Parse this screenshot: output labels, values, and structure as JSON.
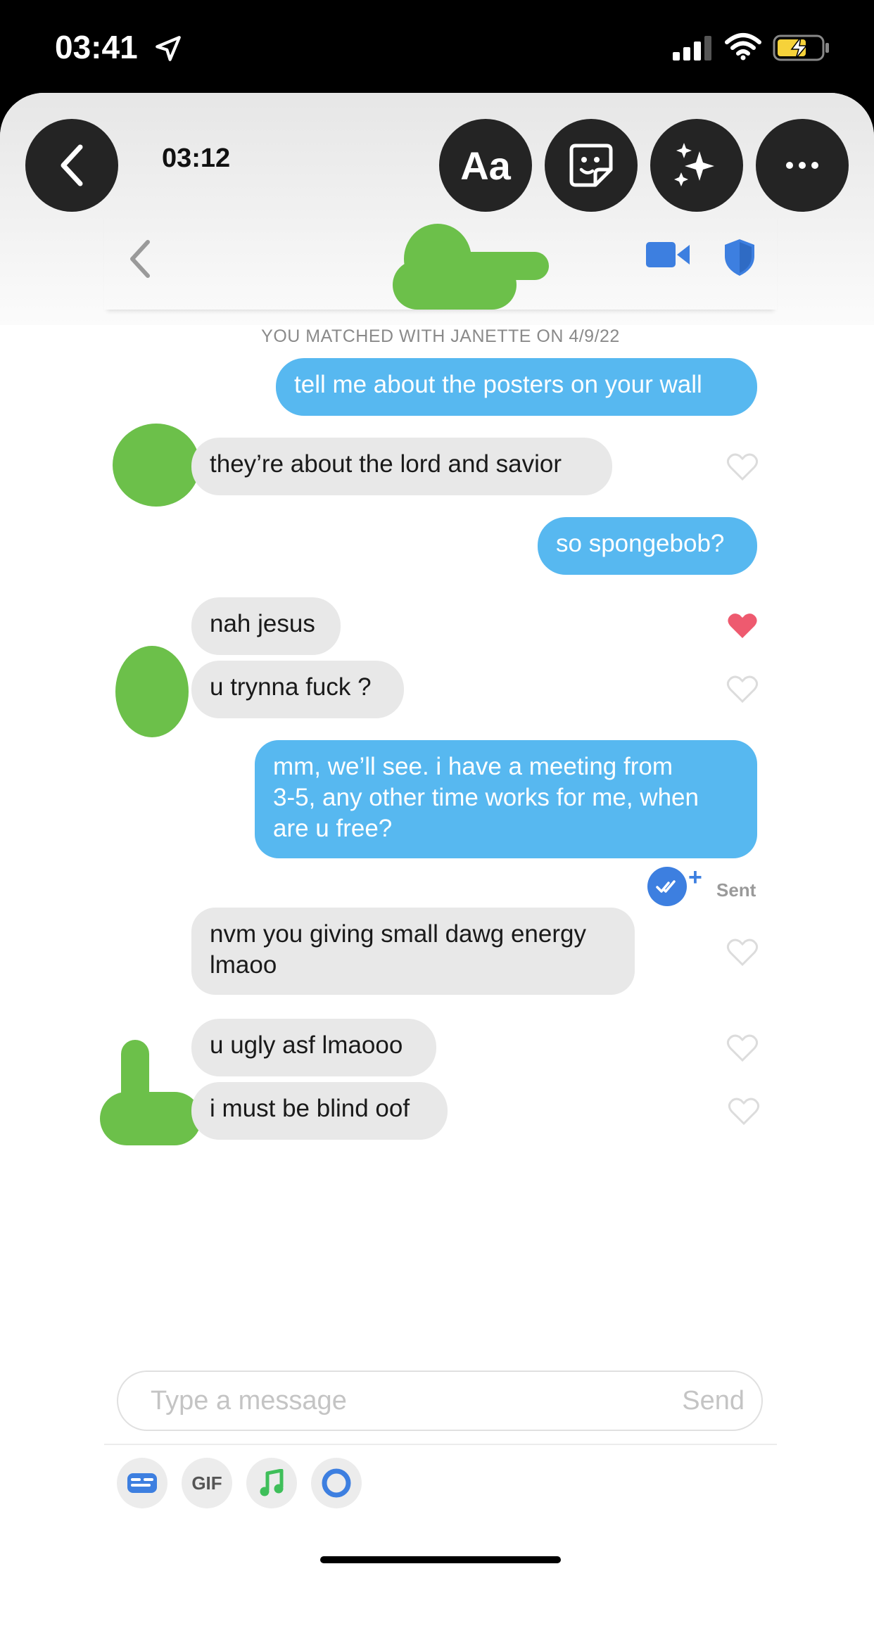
{
  "status_bar": {
    "time": "03:41",
    "icons": [
      "location-arrow-icon",
      "cellular-signal-icon",
      "wifi-icon",
      "battery-charging-icon"
    ]
  },
  "story": {
    "elapsed_time": "03:12",
    "text_tool_label": "Aa",
    "icons": [
      "back-chevron-icon",
      "sticker-icon",
      "sparkle-effects-icon",
      "more-options-icon"
    ]
  },
  "chat": {
    "header_icons": [
      "back-chevron-icon",
      "video-camera-icon",
      "shield-icon"
    ],
    "match_label": "YOU MATCHED WITH JANETTE ON 4/9/22",
    "messages": [
      {
        "from": "me",
        "text": "tell me about the posters on your wall"
      },
      {
        "from": "them",
        "text": "they’re about the lord and savior",
        "liked": false
      },
      {
        "from": "me",
        "text": "so spongebob?"
      },
      {
        "from": "them",
        "text": "nah jesus",
        "liked": true
      },
      {
        "from": "them",
        "text": "u trynna fuck ?",
        "liked": false
      },
      {
        "from": "me",
        "lines": [
          "mm, we’ll see. i have a meeting from",
          "3-5, any other time works for me, when",
          "are u free?"
        ]
      },
      {
        "from": "them",
        "lines": [
          "nvm you giving small dawg energy",
          "lmaoo"
        ],
        "liked": false
      },
      {
        "from": "them",
        "text": "u ugly asf lmaooo",
        "liked": false
      },
      {
        "from": "them",
        "text": "i must be blind oof",
        "liked": false
      }
    ],
    "sent_status": "Sent",
    "colors": {
      "outgoing": "#57b8f0",
      "incoming": "#e8e8e8",
      "liked_heart": "#ee5a6f",
      "accent": "#3d7fe0"
    }
  },
  "composer": {
    "placeholder": "Type a message",
    "send_label": "Send",
    "gif_label": "GIF",
    "tool_icons": [
      "sticker-card-icon",
      "gif-icon",
      "music-note-icon",
      "bitmoji-ring-icon"
    ]
  }
}
